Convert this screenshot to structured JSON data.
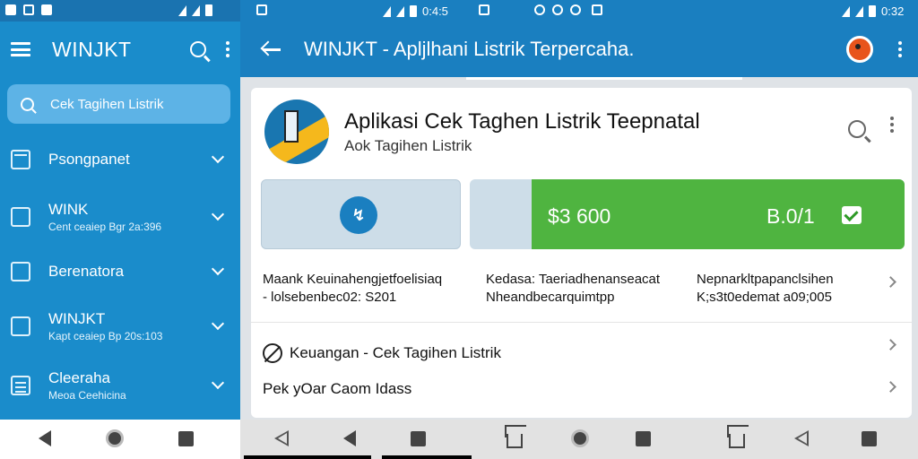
{
  "status_left": {
    "time": ""
  },
  "status_mid": {
    "time": "0:4:5"
  },
  "status_right": {
    "time": "0:32"
  },
  "drawer": {
    "title": "WINJKT",
    "search_placeholder": "Cek Tagihen Listrik",
    "items": [
      {
        "label": "Psongpanet",
        "sub": "",
        "icon": "bank-icon"
      },
      {
        "label": "WINK",
        "sub": "Cent ceaiep Bgr 2a:396",
        "icon": "document-icon"
      },
      {
        "label": "Berenatora",
        "sub": "",
        "icon": "card-icon"
      },
      {
        "label": "WINJKT",
        "sub": "Kapt ceaiep Bp 20s:103",
        "icon": "screen-icon"
      },
      {
        "label": "Cleeraha",
        "sub": "Meoa Ceehicina",
        "icon": "list-icon"
      }
    ]
  },
  "appbar": {
    "title": "WINJKT - Apljlhani Listrik Terpercaha."
  },
  "app": {
    "title": "Aplikasi Cek Taghen Listrik Teepnatal",
    "subtitle": "Aok Tagihen Listrik"
  },
  "tiles": {
    "amount": "$3 600",
    "amount2": "B.0/1"
  },
  "info": [
    {
      "line1": "Maank Keuinahengjetfoelisiaq",
      "line2": "- lolsebenbec02: S201"
    },
    {
      "line1": "Kedasa: Taeriadhenanseacat",
      "line2": "Nheandbecarquimtpp"
    },
    {
      "line1": "Nepnarkltpapanclsihen",
      "line2": "K;s3t0edemat a09;005"
    }
  ],
  "rows": [
    {
      "label": "Keuangan - Cek Tagihen Listrik"
    },
    {
      "label": "Pek yOar Caom Idass"
    }
  ],
  "colors": {
    "primary": "#1a7fc0",
    "drawer": "#1a8ccb",
    "success": "#4fb440"
  }
}
